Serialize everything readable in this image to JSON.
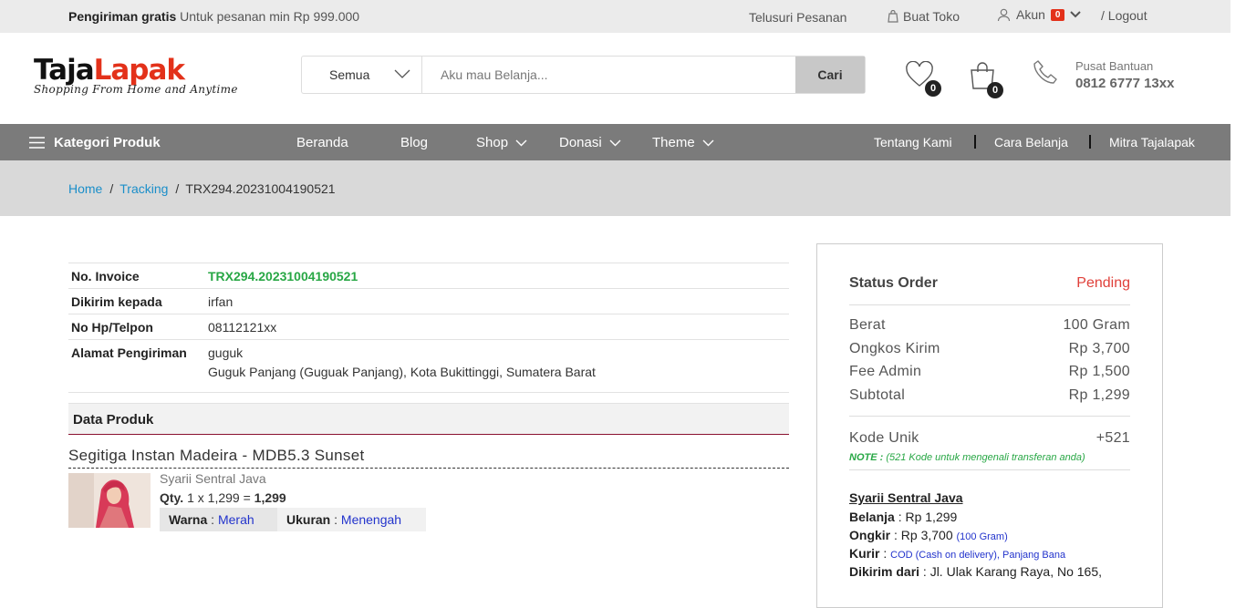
{
  "topbar": {
    "promo_bold": "Pengiriman gratis",
    "promo_text": "Untuk pesanan min Rp 999.000",
    "track": "Telusuri Pesanan",
    "store": "Buat Toko",
    "account": "Akun",
    "account_badge": "0",
    "logout": "/ Logout"
  },
  "header": {
    "logo_part1": "Taja",
    "logo_part2": "Lapak",
    "logo_tagline": "Shopping From Home and Anytime",
    "search_category": "Semua",
    "search_placeholder": "Aku mau Belanja...",
    "search_button": "Cari",
    "wishlist_count": "0",
    "cart_count": "0",
    "help_label": "Pusat Bantuan",
    "help_phone": "0812 6777 13xx"
  },
  "nav": {
    "categories": "Kategori Produk",
    "items": [
      "Beranda",
      "Blog",
      "Shop",
      "Donasi",
      "Theme"
    ],
    "right": [
      "Tentang Kami",
      "Cara Belanja",
      "Mitra Tajalapak"
    ]
  },
  "breadcrumb": {
    "home": "Home",
    "tracking": "Tracking",
    "current": "TRX294.20231004190521"
  },
  "invoice": {
    "rows": [
      {
        "label": "No. Invoice",
        "value": "TRX294.20231004190521"
      },
      {
        "label": "Dikirim kepada",
        "value": "irfan"
      },
      {
        "label": "No Hp/Telpon",
        "value": "08112121xx"
      },
      {
        "label": "Alamat Pengiriman",
        "value": "guguk",
        "value2": "Guguk Panjang (Guguak Panjang), Kota Bukittinggi, Sumatera Barat"
      }
    ]
  },
  "product": {
    "section_title": "Data Produk",
    "name": "Segitiga Instan Madeira - MDB5.3 Sunset",
    "seller": "Syarii Sentral Java",
    "qty_label": "Qty.",
    "qty_expr": "1 x 1,299 =",
    "qty_total": "1,299",
    "attr1_label": "Warna",
    "attr1_value": "Merah",
    "attr2_label": "Ukuran",
    "attr2_value": "Menengah"
  },
  "order": {
    "status_label": "Status Order",
    "status_value": "Pending",
    "lines": [
      {
        "label": "Berat",
        "value": "100 Gram"
      },
      {
        "label": "Ongkos Kirim",
        "value": "Rp 3,700"
      },
      {
        "label": "Fee Admin",
        "value": "Rp 1,500"
      },
      {
        "label": "Subtotal",
        "value": "Rp 1,299"
      }
    ],
    "unique_label": "Kode Unik",
    "unique_value": "+521",
    "note_bold": "NOTE :",
    "note_text": "(521 Kode untuk mengenali transferan anda)",
    "shipping": {
      "seller": "Syarii Sentral Java",
      "belanja_label": "Belanja",
      "belanja_value": ": Rp 1,299",
      "ongkir_label": "Ongkir",
      "ongkir_value": ": Rp 3,700",
      "ongkir_small": "(100 Gram)",
      "kurir_label": "Kurir",
      "kurir_value": "COD (Cash on delivery), Panjang Bana",
      "dari_label": "Dikirim dari",
      "dari_value": ": Jl. Ulak Karang Raya, No 165,"
    }
  },
  "colors": {
    "accent_red": "#e3311a",
    "nav_bg": "#7b7b7b",
    "link_blue": "#1a8ec9",
    "green": "#28a745"
  }
}
